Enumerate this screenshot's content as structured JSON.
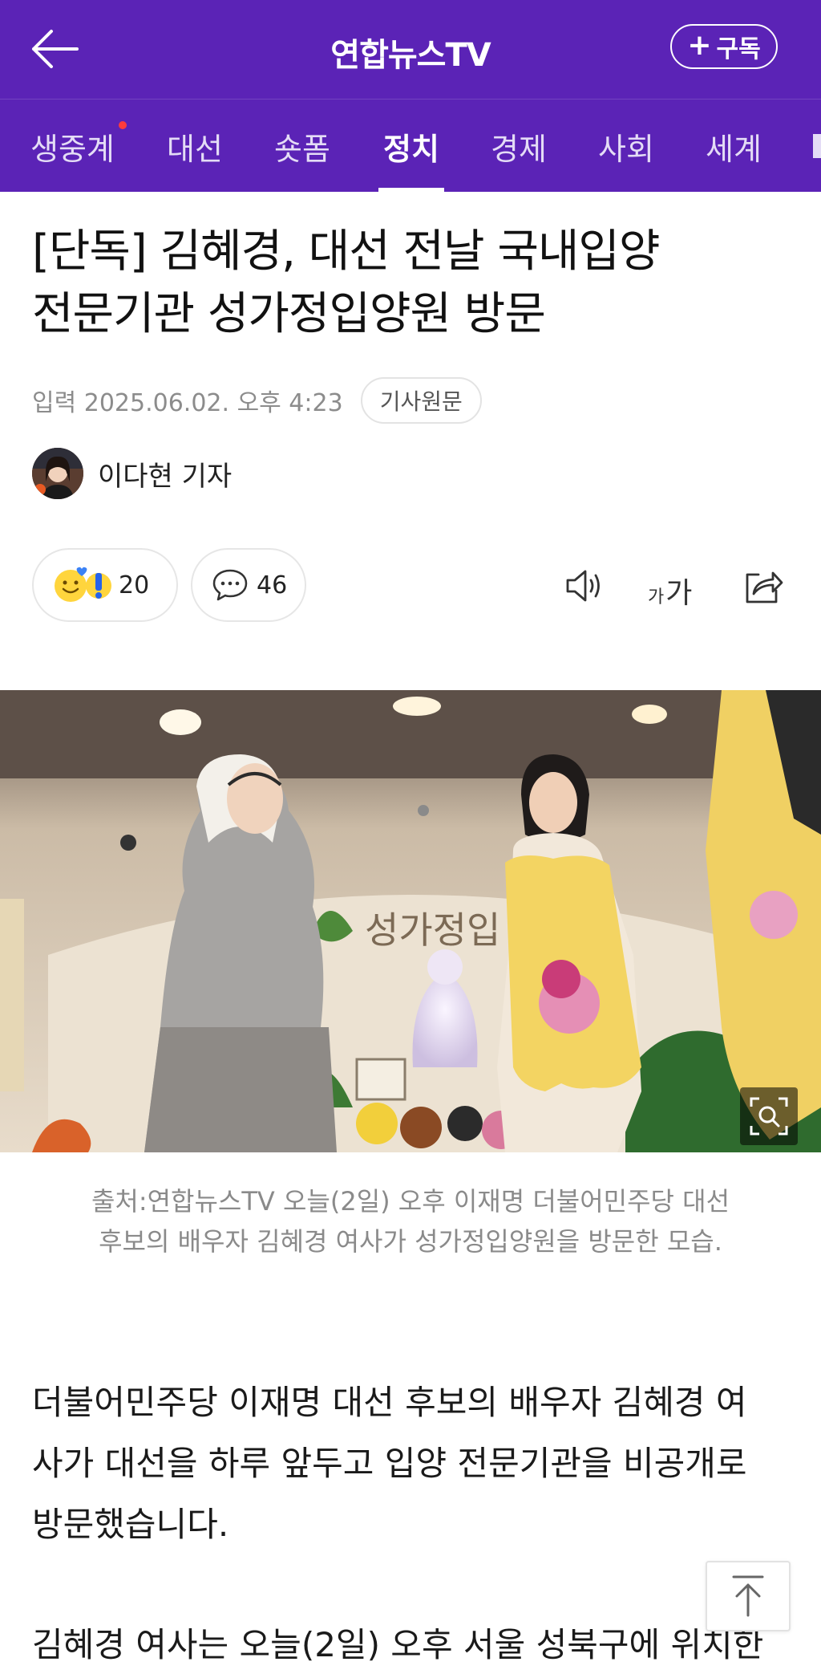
{
  "header": {
    "brand": "연합뉴스TV",
    "subscribe_label": "구독"
  },
  "tabs": [
    {
      "label": "생중계",
      "live": true
    },
    {
      "label": "대선"
    },
    {
      "label": "숏폼"
    },
    {
      "label": "정치",
      "active": true
    },
    {
      "label": "경제"
    },
    {
      "label": "사회"
    },
    {
      "label": "세계"
    }
  ],
  "article": {
    "headline_line1": "[단독] 김혜경, 대선 전날 국내입양",
    "headline_line2": "전문기관 성가정입양원 방문",
    "published": "입력 2025.06.02. 오후 4:23",
    "original_button": "기사원문",
    "reporter": "이다현 기자",
    "reaction_count": "20",
    "comment_count": "46",
    "font_size_glyph_small": "가",
    "font_size_glyph_large": "가",
    "photo_sign_text": "성가정입",
    "caption_line1": "출처:연합뉴스TV 오늘(2일) 오후 이재명 더불어민주당 대선",
    "caption_line2": "후보의 배우자 김혜경 여사가 성가정입양원을 방문한 모습.",
    "para1_line1": "더불어민주당 이재명 대선 후보의 배우자 김혜경 여",
    "para1_line2": "사가 대선을 하루 앞두고 입양 전문기관을 비공개로",
    "para1_line3": "방문했습니다.",
    "para2_line1": "김혜경 여사는 오늘(2일) 오후 서울 성북구에 위치한"
  },
  "colors": {
    "brand_purple": "#5b23b6",
    "live_dot": "#ff3b3b"
  },
  "icons": [
    "back-arrow-icon",
    "plus-icon",
    "smile-emoji-icon",
    "surprise-emoji-icon",
    "speech-bubble-icon",
    "speaker-icon",
    "share-icon",
    "zoom-search-icon",
    "arrow-up-icon"
  ]
}
